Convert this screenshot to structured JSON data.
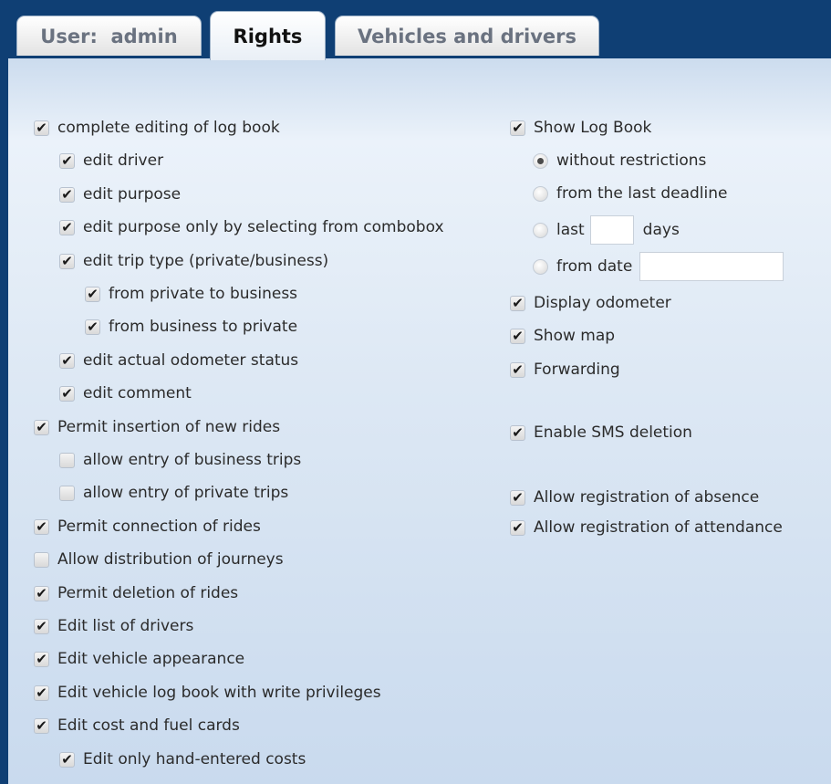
{
  "tabs": [
    {
      "label": "User:  admin",
      "active": false
    },
    {
      "label": "Rights",
      "active": true
    },
    {
      "label": "Vehicles and drivers",
      "active": false
    }
  ],
  "left_options": [
    {
      "label": "complete editing of log book",
      "checked": true
    },
    {
      "label": "edit driver",
      "checked": true
    },
    {
      "label": "edit purpose",
      "checked": true
    },
    {
      "label": "edit purpose only by selecting from combobox",
      "checked": true
    },
    {
      "label": "edit trip type (private/business)",
      "checked": true
    },
    {
      "label": "from private to business",
      "checked": true
    },
    {
      "label": "from business to private",
      "checked": true
    },
    {
      "label": "edit actual odometer status",
      "checked": true
    },
    {
      "label": "edit comment",
      "checked": true
    },
    {
      "label": "Permit insertion of new rides",
      "checked": true
    },
    {
      "label": "allow entry of business trips",
      "checked": false
    },
    {
      "label": "allow entry of private trips",
      "checked": false
    },
    {
      "label": "Permit connection of rides",
      "checked": true
    },
    {
      "label": "Allow distribution of journeys",
      "checked": false
    },
    {
      "label": "Permit deletion of rides",
      "checked": true
    },
    {
      "label": "Edit list of drivers",
      "checked": true
    },
    {
      "label": "Edit vehicle appearance",
      "checked": true
    },
    {
      "label": "Edit vehicle log book with write privileges",
      "checked": true
    },
    {
      "label": "Edit cost and fuel cards",
      "checked": true
    },
    {
      "label": "Edit only hand-entered costs",
      "checked": true
    }
  ],
  "log_book": {
    "show_label": "Show Log Book",
    "show_checked": true,
    "options": [
      {
        "label": "without restrictions",
        "selected": true
      },
      {
        "label": "from the last deadline",
        "selected": false
      },
      {
        "label": "last",
        "selected": false,
        "suffix": "days",
        "input_value": ""
      },
      {
        "label": "from date",
        "selected": false,
        "input_value": ""
      }
    ]
  },
  "right_options": [
    {
      "label": "Display odometer",
      "checked": true
    },
    {
      "label": "Show map",
      "checked": true
    },
    {
      "label": "Forwarding",
      "checked": true
    },
    {
      "label": "Enable SMS deletion",
      "checked": true
    },
    {
      "label": "Allow registration of absence",
      "checked": true
    },
    {
      "label": "Allow registration of attendance",
      "checked": true
    }
  ],
  "check_glyph": "✔"
}
